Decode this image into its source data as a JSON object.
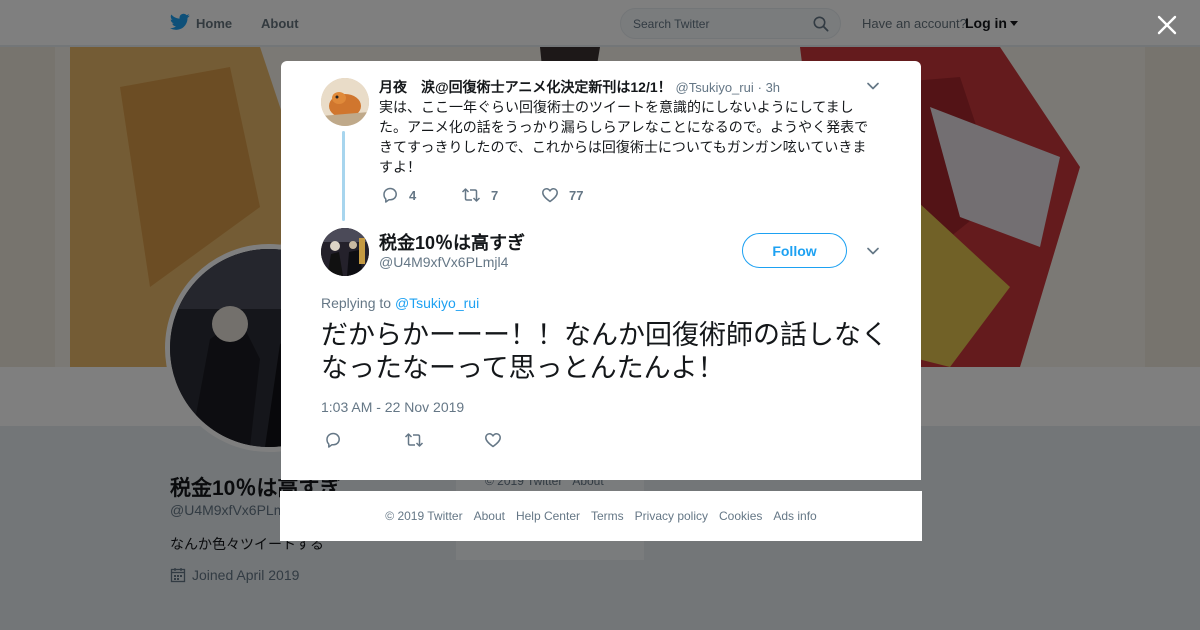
{
  "topbar": {
    "nav_home": "Home",
    "nav_about": "About",
    "search_placeholder": "Search Twitter",
    "have_account": "Have an account?",
    "login": "Log in",
    "brand_color": "#1da1f2"
  },
  "profile": {
    "name": "税金10％は高すぎ",
    "handle": "@U4M9xfVx6PLmjl4",
    "bio": "なんか色々ツイートする",
    "joined": "Joined April 2019"
  },
  "sidebar_footer": {
    "copyright": "© 2019 Twitter",
    "about": "About"
  },
  "modal": {
    "parent_tweet": {
      "name": "月夜　涙@回復術士アニメ化決定新刊は12/1！",
      "handle": "@Tsukiyo_rui",
      "time": "· 3h",
      "text": "実は、ここ一年ぐらい回復術士のツイートを意識的にしないようにしてました。アニメ化の話をうっかり漏らしらアレなことになるので。ようやく発表できてすっきりしたので、これからは回復術士についてもガンガン呟いていきますよ！",
      "replies": "4",
      "retweets": "7",
      "likes": "77"
    },
    "main_tweet": {
      "name": "税金10％は高すぎ",
      "handle": "@U4M9xfVx6PLmjl4",
      "follow_label": "Follow",
      "replying_prefix": "Replying to",
      "replying_to": "@Tsukiyo_rui",
      "text": "だからかーーー！！なんか回復術師の話しなくなったなーって思っとんたんよ！",
      "date": "1:03 AM - 22 Nov 2019"
    }
  },
  "footer": {
    "links": [
      "© 2019 Twitter",
      "About",
      "Help Center",
      "Terms",
      "Privacy policy",
      "Cookies",
      "Ads info"
    ]
  }
}
